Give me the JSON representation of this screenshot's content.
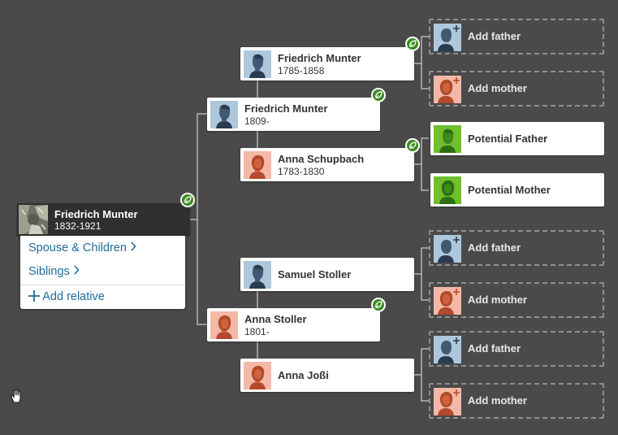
{
  "root": {
    "name": "Friedrich Munter",
    "dates": "1832-1921",
    "menu": {
      "spouse_children": "Spouse & Children",
      "siblings": "Siblings",
      "add_relative": "Add relative"
    }
  },
  "parents": {
    "father": {
      "name": "Friedrich Munter",
      "dates": "1809-"
    },
    "mother": {
      "name": "Anna Stoller",
      "dates": "1801-"
    }
  },
  "grandparents": {
    "paternal_grandfather": {
      "name": "Friedrich Munter",
      "dates": "1785-1858"
    },
    "paternal_grandmother": {
      "name": "Anna Schupbach",
      "dates": "1783-1830"
    },
    "maternal_grandfather": {
      "name": "Samuel Stoller"
    },
    "maternal_grandmother": {
      "name": "Anna Joßi"
    }
  },
  "great_grandparents": {
    "add_father": "Add father",
    "add_mother": "Add mother",
    "potential_father": "Potential Father",
    "potential_mother": "Potential Mother"
  },
  "colors": {
    "background": "#4a4a4a",
    "hint_green": "#3b8c1f",
    "male_avatar": "#aec7da",
    "female_avatar": "#f3b9a6",
    "potential_avatar": "#6fbf2e",
    "link_blue": "#1d6d9a"
  }
}
